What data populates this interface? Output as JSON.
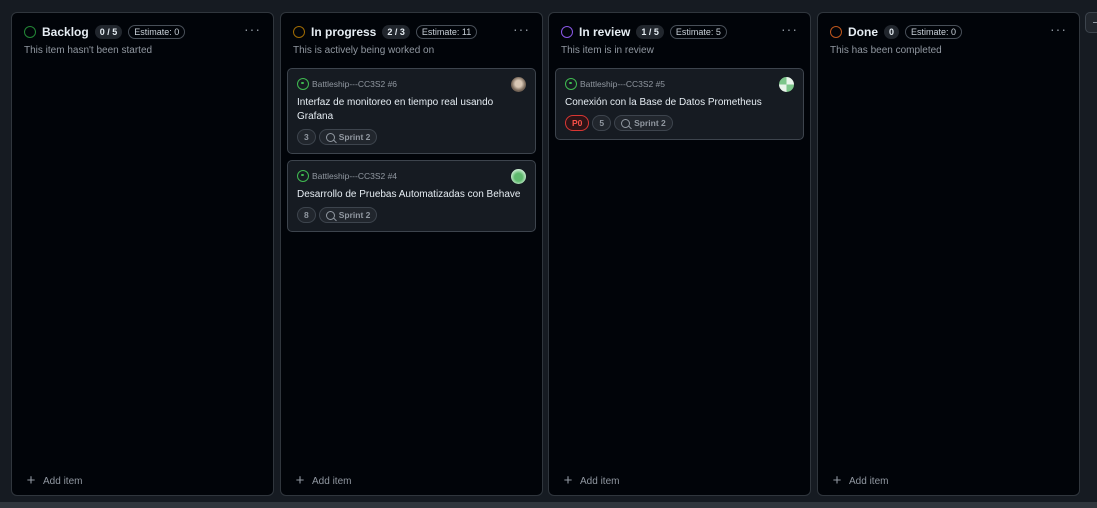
{
  "columns": [
    {
      "title": "Backlog",
      "count": "0 / 5",
      "estimate": "Estimate: 0",
      "description": "This item hasn't been started",
      "status_color": "#238636",
      "add_label": "Add item",
      "cards": []
    },
    {
      "title": "In progress",
      "count": "2 / 3",
      "estimate": "Estimate: 11",
      "description": "This is actively being worked on",
      "status_color": "#9e6a03",
      "add_label": "Add item",
      "cards": [
        {
          "ref": "Battleship---CC3S2 #6",
          "title": "Interfaz de monitoreo en tiempo real usando Grafana",
          "points": "3",
          "iteration": "Sprint 2"
        },
        {
          "ref": "Battleship---CC3S2 #4",
          "title": "Desarrollo de Pruebas Automatizadas con Behave",
          "points": "8",
          "iteration": "Sprint 2"
        }
      ]
    },
    {
      "title": "In review",
      "count": "1 / 5",
      "estimate": "Estimate: 5",
      "description": "This item is in review",
      "status_color": "#8957e5",
      "add_label": "Add item",
      "cards": [
        {
          "ref": "Battleship---CC3S2 #5",
          "title": "Conexión con la Base de Datos Prometheus",
          "priority": "P0",
          "points": "5",
          "iteration": "Sprint 2"
        }
      ]
    },
    {
      "title": "Done",
      "count": "0",
      "estimate": "Estimate: 0",
      "description": "This has been completed",
      "status_color": "#bd561d",
      "add_label": "Add item",
      "cards": []
    }
  ],
  "icons": {
    "column_menu": "kebab-horizontal-icon",
    "issue_open": "issue-opened-icon",
    "iteration": "iteration-icon",
    "add": "plus-icon"
  }
}
